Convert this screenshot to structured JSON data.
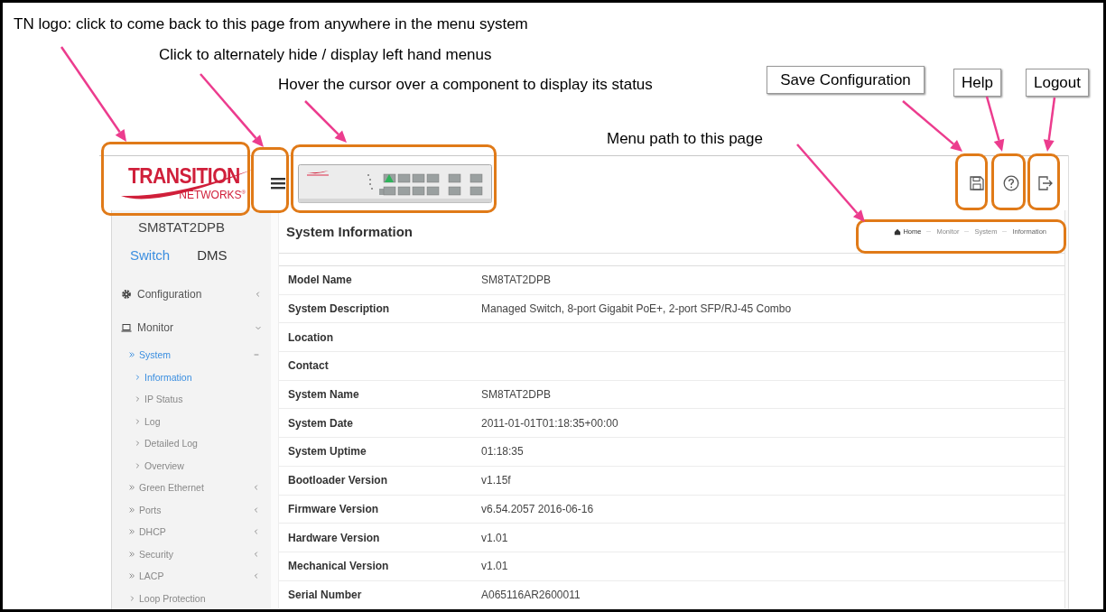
{
  "annotations": {
    "callouts": [
      {
        "text": "TN logo: click to come back to this page from anywhere in the menu system"
      },
      {
        "text": "Click to alternately hide / display left hand menus"
      },
      {
        "text": "Hover the cursor over a component to display its status"
      },
      {
        "text": "Menu path to this page"
      }
    ],
    "buttons": [
      "Save Configuration",
      "Help",
      "Logout"
    ]
  },
  "header": {
    "logo": {
      "brand": "TRANSITION",
      "sub": "NETWORKS",
      "mark": "®"
    }
  },
  "sidebar": {
    "device": "SM8TAT2DPB",
    "tabs": [
      {
        "label": "Switch",
        "selected": true
      },
      {
        "label": "DMS",
        "selected": false
      }
    ],
    "menu": [
      {
        "label": "Configuration",
        "expanded": false,
        "selected": false
      },
      {
        "label": "Monitor",
        "expanded": true,
        "selected": false,
        "children": [
          {
            "label": "System",
            "expanded": true,
            "selected": true,
            "children": [
              {
                "label": "Information",
                "selected": true
              },
              {
                "label": "IP Status",
                "selected": false
              },
              {
                "label": "Log",
                "selected": false
              },
              {
                "label": "Detailed Log",
                "selected": false
              },
              {
                "label": "Overview",
                "selected": false
              }
            ]
          },
          {
            "label": "Green Ethernet",
            "expanded": false,
            "selected": false
          },
          {
            "label": "Ports",
            "expanded": false,
            "selected": false
          },
          {
            "label": "DHCP",
            "expanded": false,
            "selected": false
          },
          {
            "label": "Security",
            "expanded": false,
            "selected": false
          },
          {
            "label": "LACP",
            "expanded": false,
            "selected": false
          },
          {
            "label": "Loop Protection",
            "selected": false
          }
        ]
      }
    ]
  },
  "main": {
    "title": "System Information",
    "breadcrumb": [
      "Home",
      "Monitor",
      "System",
      "Information"
    ],
    "rows": [
      {
        "label": "Model Name",
        "value": "SM8TAT2DPB"
      },
      {
        "label": "System Description",
        "value": "Managed Switch, 8-port Gigabit PoE+, 2-port SFP/RJ-45 Combo"
      },
      {
        "label": "Location"
      },
      {
        "label": "Contact"
      },
      {
        "label": "System Name",
        "value": "SM8TAT2DPB"
      },
      {
        "label": "System Date",
        "value": "2011-01-01T01:18:35+00:00"
      },
      {
        "label": "System Uptime",
        "value": "01:18:35"
      },
      {
        "label": "Bootloader Version",
        "value": "v1.15f"
      },
      {
        "label": "Firmware Version",
        "value": "v6.54.2057 2016-06-16"
      },
      {
        "label": "Hardware Version",
        "value": "v1.01"
      },
      {
        "label": "Mechanical Version",
        "value": "v1.01"
      },
      {
        "label": "Serial Number",
        "value": "A065116AR2600011"
      }
    ]
  }
}
